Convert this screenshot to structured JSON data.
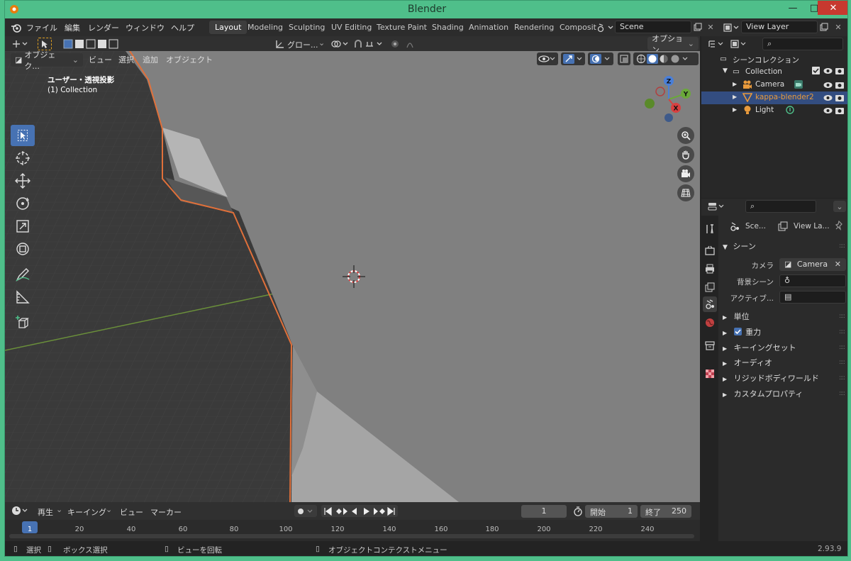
{
  "window": {
    "title": "Blender"
  },
  "menu": [
    "ファイル",
    "編集",
    "レンダー",
    "ウィンドウ",
    "ヘルプ"
  ],
  "workspaces": [
    {
      "label": "Layout",
      "active": true
    },
    {
      "label": "Modeling"
    },
    {
      "label": "Sculpting"
    },
    {
      "label": "UV Editing"
    },
    {
      "label": "Texture Paint"
    },
    {
      "label": "Shading"
    },
    {
      "label": "Animation"
    },
    {
      "label": "Rendering"
    },
    {
      "label": "Composit"
    }
  ],
  "scene_field": "Scene",
  "view_layer_field": "View Layer",
  "viewport_header": {
    "transform_orientation": "グロー...",
    "options": "オプション"
  },
  "viewport_header2": {
    "mode": "オブジェク...",
    "view": "ビュー",
    "select": "選択",
    "add": "追加",
    "object": "オブジェクト"
  },
  "viewport": {
    "projection": "ユーザー・透視投影",
    "collection": "(1) Collection",
    "gizmo": {
      "x": "X",
      "y": "Y",
      "z": "Z"
    }
  },
  "tools": [
    {
      "name": "select-box-tool",
      "icon": "cursor-arrow-icon",
      "active": true
    },
    {
      "name": "cursor-tool",
      "icon": "crosshair-circle-icon"
    },
    {
      "name": "move-tool",
      "icon": "move-arrows-icon"
    },
    {
      "name": "rotate-tool",
      "icon": "rotate-icon"
    },
    {
      "name": "scale-tool",
      "icon": "scale-icon"
    },
    {
      "name": "transform-tool",
      "icon": "transform-icon"
    },
    {
      "name": "annotate-tool",
      "icon": "pencil-icon"
    },
    {
      "name": "measure-tool",
      "icon": "ruler-icon"
    },
    {
      "name": "add-cube-tool",
      "icon": "cube-add-icon"
    }
  ],
  "outliner": {
    "root": "シーンコレクション",
    "collection": "Collection",
    "items": [
      {
        "label": "Camera",
        "icon": "camera-object-icon",
        "selected": false
      },
      {
        "label": "kappa-blender2",
        "icon": "mesh-object-icon",
        "selected": true
      },
      {
        "label": "Light",
        "icon": "light-object-icon",
        "selected": false
      }
    ]
  },
  "properties": {
    "breadcrumb_scene": "Sce...",
    "breadcrumb_layer": "View La...",
    "panel_title": "シーン",
    "camera_label": "カメラ",
    "camera_value": "Camera",
    "background_label": "背景シーン",
    "active_label": "アクティブ...",
    "subpanels": [
      {
        "label": "単位"
      },
      {
        "label": "重力",
        "checkbox": true
      },
      {
        "label": "キーイングセット"
      },
      {
        "label": "オーディオ"
      },
      {
        "label": "リジッドボディワールド"
      },
      {
        "label": "カスタムプロパティ"
      }
    ]
  },
  "timeline": {
    "playback": "再生",
    "keying": "キーイング",
    "view": "ビュー",
    "marker": "マーカー",
    "current_frame": "1",
    "start_label": "開始",
    "start_value": "1",
    "end_label": "終了",
    "end_value": "250",
    "ticks": [
      "1",
      "20",
      "40",
      "60",
      "80",
      "100",
      "120",
      "140",
      "160",
      "180",
      "200",
      "220",
      "240"
    ]
  },
  "status": {
    "select": "選択",
    "box_select": "ボックス選択",
    "rotate_view": "ビューを回転",
    "context_menu": "オブジェクトコンテクストメニュー",
    "version": "2.93.9"
  },
  "colors": {
    "accent": "#4772b3",
    "selected_row": "#334d80",
    "outline": "#e0703a",
    "title_bar": "#4fbf8a"
  }
}
